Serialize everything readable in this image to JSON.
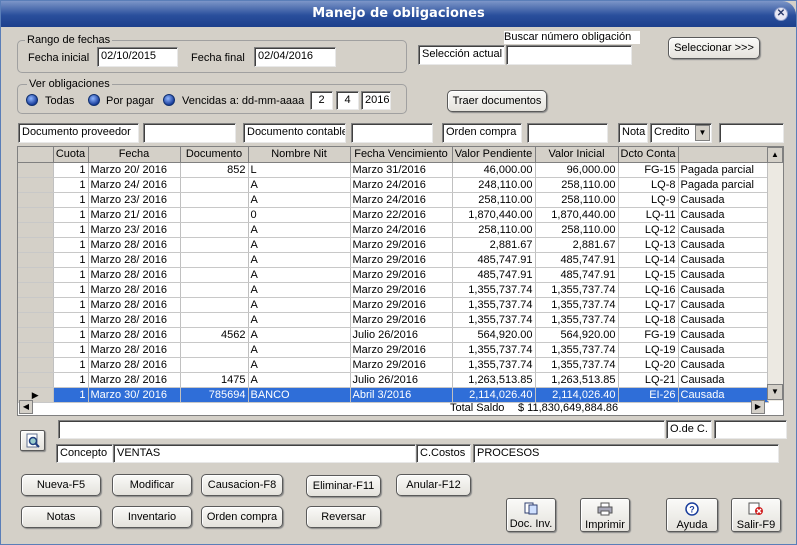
{
  "window": {
    "title": "Manejo de obligaciones"
  },
  "rango": {
    "legend": "Rango de fechas",
    "inicial_label": "Fecha inicial",
    "inicial": "02/10/2015",
    "final_label": "Fecha final",
    "final": "02/04/2016"
  },
  "buscar": {
    "title": "Buscar número obligación",
    "seleccion_label": "Selección actual",
    "seleccion_value": "",
    "button": "Seleccionar >>>"
  },
  "ver": {
    "legend": "Ver obligaciones",
    "todas": "Todas",
    "por_pagar": "Por pagar",
    "vencidas": "Vencidas a: dd-mm-aaaa",
    "dd": "2",
    "mm": "4",
    "aaaa": "2016",
    "traer": "Traer documentos"
  },
  "filters": {
    "doc_proveedor": "Documento proveedor",
    "doc_contable": "Documento contable",
    "orden_compra": "Orden compra",
    "nota": "Nota",
    "nota_value": "Credito"
  },
  "table": {
    "headers": [
      "",
      "Cuota",
      "Fecha",
      "Documento",
      "Nombre Nit",
      "Fecha Vencimiento",
      "Valor Pendiente",
      "Valor Inicial",
      "Dcto Conta",
      ""
    ],
    "rows": [
      [
        "1",
        "Marzo  20/ 2016",
        "852",
        "L",
        "Marzo  31/2016",
        "46,000.00",
        "96,000.00",
        "FG-15",
        "Pagada parcial"
      ],
      [
        "1",
        "Marzo  24/ 2016",
        "",
        "A",
        "Marzo  24/2016",
        "248,110.00",
        "258,110.00",
        "LQ-8",
        "Pagada parcial"
      ],
      [
        "1",
        "Marzo  23/ 2016",
        "",
        "A",
        "Marzo  24/2016",
        "258,110.00",
        "258,110.00",
        "LQ-9",
        "Causada"
      ],
      [
        "1",
        "Marzo  21/ 2016",
        "",
        "0",
        "Marzo  22/2016",
        "1,870,440.00",
        "1,870,440.00",
        "LQ-11",
        "Causada"
      ],
      [
        "1",
        "Marzo  23/ 2016",
        "",
        "A",
        "Marzo  24/2016",
        "258,110.00",
        "258,110.00",
        "LQ-12",
        "Causada"
      ],
      [
        "1",
        "Marzo  28/ 2016",
        "",
        "A",
        "Marzo  29/2016",
        "2,881.67",
        "2,881.67",
        "LQ-13",
        "Causada"
      ],
      [
        "1",
        "Marzo  28/ 2016",
        "",
        "A",
        "Marzo  29/2016",
        "485,747.91",
        "485,747.91",
        "LQ-14",
        "Causada"
      ],
      [
        "1",
        "Marzo  28/ 2016",
        "",
        "A",
        "Marzo  29/2016",
        "485,747.91",
        "485,747.91",
        "LQ-15",
        "Causada"
      ],
      [
        "1",
        "Marzo  28/ 2016",
        "",
        "A",
        "Marzo  29/2016",
        "1,355,737.74",
        "1,355,737.74",
        "LQ-16",
        "Causada"
      ],
      [
        "1",
        "Marzo  28/ 2016",
        "",
        "A",
        "Marzo  29/2016",
        "1,355,737.74",
        "1,355,737.74",
        "LQ-17",
        "Causada"
      ],
      [
        "1",
        "Marzo  28/ 2016",
        "",
        "A",
        "Marzo  29/2016",
        "1,355,737.74",
        "1,355,737.74",
        "LQ-18",
        "Causada"
      ],
      [
        "1",
        "Marzo  28/ 2016",
        "4562",
        "A",
        "Julio  26/2016",
        "564,920.00",
        "564,920.00",
        "FG-19",
        "Causada"
      ],
      [
        "1",
        "Marzo  28/ 2016",
        "",
        "A",
        "Marzo  29/2016",
        "1,355,737.74",
        "1,355,737.74",
        "LQ-19",
        "Causada"
      ],
      [
        "1",
        "Marzo  28/ 2016",
        "",
        "A",
        "Marzo  29/2016",
        "1,355,737.74",
        "1,355,737.74",
        "LQ-20",
        "Causada"
      ],
      [
        "1",
        "Marzo  28/ 2016",
        "1475",
        "A",
        "Julio  26/2016",
        "1,263,513.85",
        "1,263,513.85",
        "LQ-21",
        "Causada"
      ],
      [
        "1",
        "Marzo  30/ 2016",
        "785694",
        "BANCO",
        "Abril  3/2016",
        "2,114,026.40",
        "2,114,026.40",
        "EI-26",
        "Causada"
      ]
    ],
    "total_label": "Total Saldo",
    "total_value": "$ 11,830,649,884.86"
  },
  "detail": {
    "odec": "O.de C.",
    "concepto_label": "Concepto",
    "concepto": "VENTAS",
    "ccostos_label": "C.Costos",
    "ccostos": "PROCESOS"
  },
  "buttons": {
    "nueva": "Nueva-F5",
    "modificar": "Modificar",
    "causacion": "Causacion-F8",
    "eliminar": "Eliminar-F11",
    "anular": "Anular-F12",
    "notas": "Notas",
    "inventario": "Inventario",
    "orden_compra": "Orden compra",
    "reversar": "Reversar",
    "doc_inv": "Doc. Inv.",
    "imprimir": "Imprimir",
    "ayuda": "Ayuda",
    "salir": "Salir-F9"
  },
  "colors": {
    "title_bar": "#1c3f8c",
    "selection": "#2f6ed8",
    "dialog_bg": "#d4d0c8"
  }
}
